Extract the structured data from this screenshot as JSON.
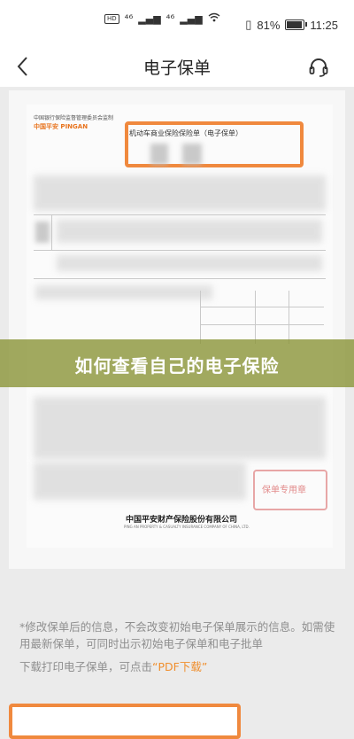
{
  "status_bar": {
    "sim1": "HD",
    "sim2": "HD",
    "signal1": "⁴⁶",
    "signal2": "⁴⁶",
    "battery_percent": "81%",
    "time": "11:25"
  },
  "nav": {
    "title": "电子保单",
    "back_icon": "chevron-left-icon",
    "service_icon": "headset-icon"
  },
  "document": {
    "org_text": "中国银行保险监督管理委员会监制",
    "logo_text": "中国平安 PINGAN",
    "title": "机动车商业保险保险单（电子保单）",
    "stamp_text": "保单专用章",
    "company_cn": "中国平安财产保险股份有限公司",
    "company_en": "PING AN PROPERTY & CASUALTY INSURANCE COMPANY OF CHINA, LTD."
  },
  "banner": {
    "text": "如何查看自己的电子保险"
  },
  "notice": {
    "text": "*修改保单后的信息，不会改变初始电子保单展示的信息。如需使用最新保单，可同时出示初始电子保单和电子批单",
    "download_prefix": "下载打印电子保单，可点击",
    "download_link": "“PDF下载”"
  },
  "colors": {
    "highlight": "#f0893e",
    "banner_bg": "#8c963c",
    "link": "#f08f2e"
  }
}
